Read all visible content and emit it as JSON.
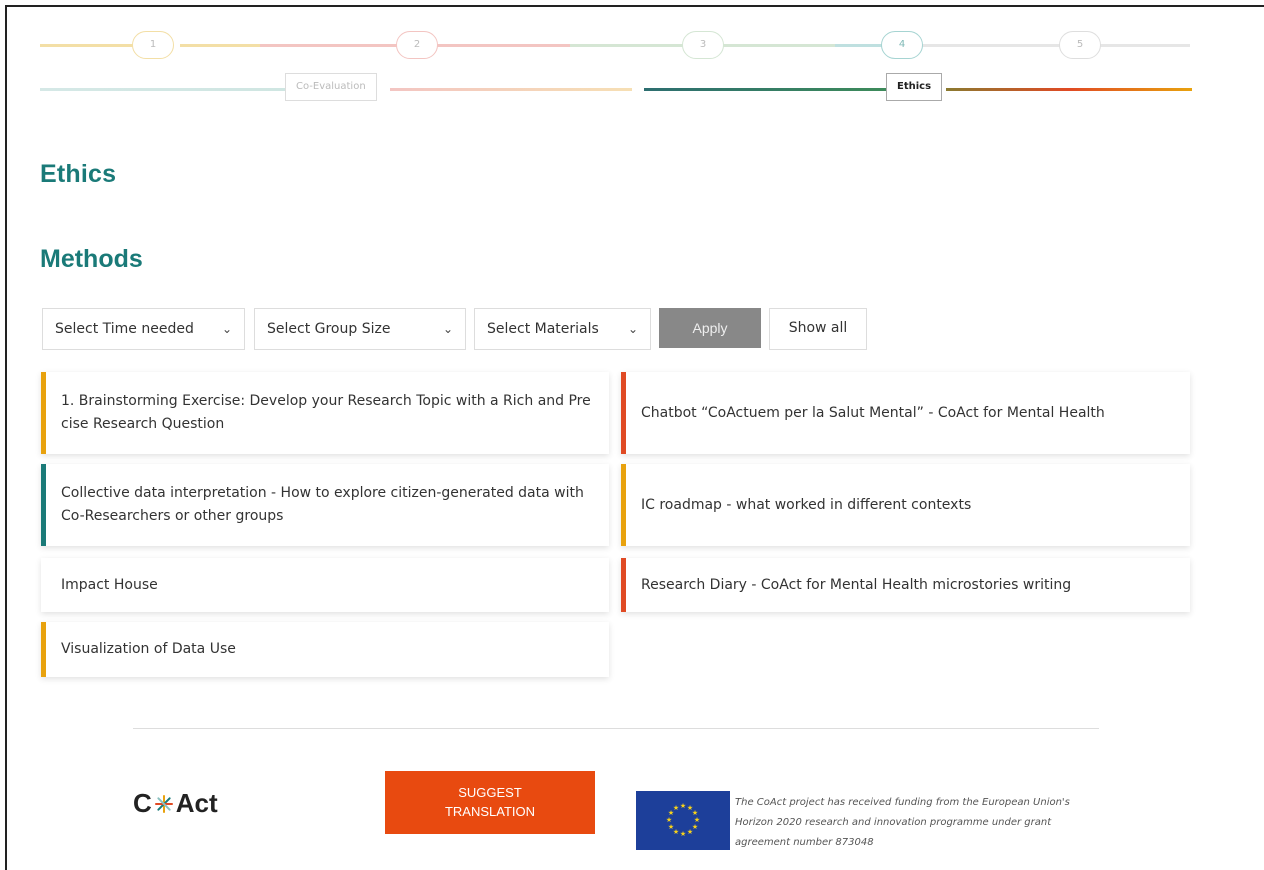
{
  "stepper": {
    "steps": [
      "1",
      "2",
      "3",
      "4",
      "5"
    ],
    "phases": [
      "Co-Evaluation",
      "Ethics"
    ],
    "colors": {
      "yellow": "#f3dfa6",
      "pink": "#f3c5c2",
      "green": "#cfe3d5",
      "teal": "#bfe0e0",
      "grey": "#e6e6e6"
    }
  },
  "section_title": "Ethics",
  "methods_title": "Methods",
  "filters": {
    "time": "Select Time needed",
    "group": "Select Group Size",
    "materials": "Select Materials",
    "apply": "Apply",
    "show_all": "Show all"
  },
  "methods": [
    {
      "title": "1. Brainstorming Exercise: Develop your Research Topic with a Rich and Precise Research Question",
      "accent": "#e8a20e"
    },
    {
      "title": "Chatbot “CoActuem per la Salut Mental” - CoAct for Mental Health",
      "accent": "#e04a24"
    },
    {
      "title": "Collective data interpretation - How to explore citizen-generated data with Co-Researchers or other groups",
      "accent": "#1a7a78"
    },
    {
      "title": "IC roadmap - what worked in different contexts",
      "accent": "#e8a20e"
    },
    {
      "title": "Impact House",
      "accent": ""
    },
    {
      "title": "Research Diary - CoAct for Mental Health microstories writing",
      "accent": "#e04a24"
    },
    {
      "title": "Visualization of Data Use",
      "accent": "#e8a20e"
    }
  ],
  "footer": {
    "logo_text_left": "C",
    "logo_text_right": "Act",
    "suggest_line1": "SUGGEST",
    "suggest_line2": "TRANSLATION",
    "funding_line1": "The CoAct project has received funding from the European Union's",
    "funding_line2": "Horizon 2020 research and innovation programme under grant",
    "funding_line3": "agreement number 873048"
  },
  "brand_colors": {
    "teal": "#1a7a78",
    "orange": "#e84a10",
    "eu_blue": "#1d3f9a"
  }
}
